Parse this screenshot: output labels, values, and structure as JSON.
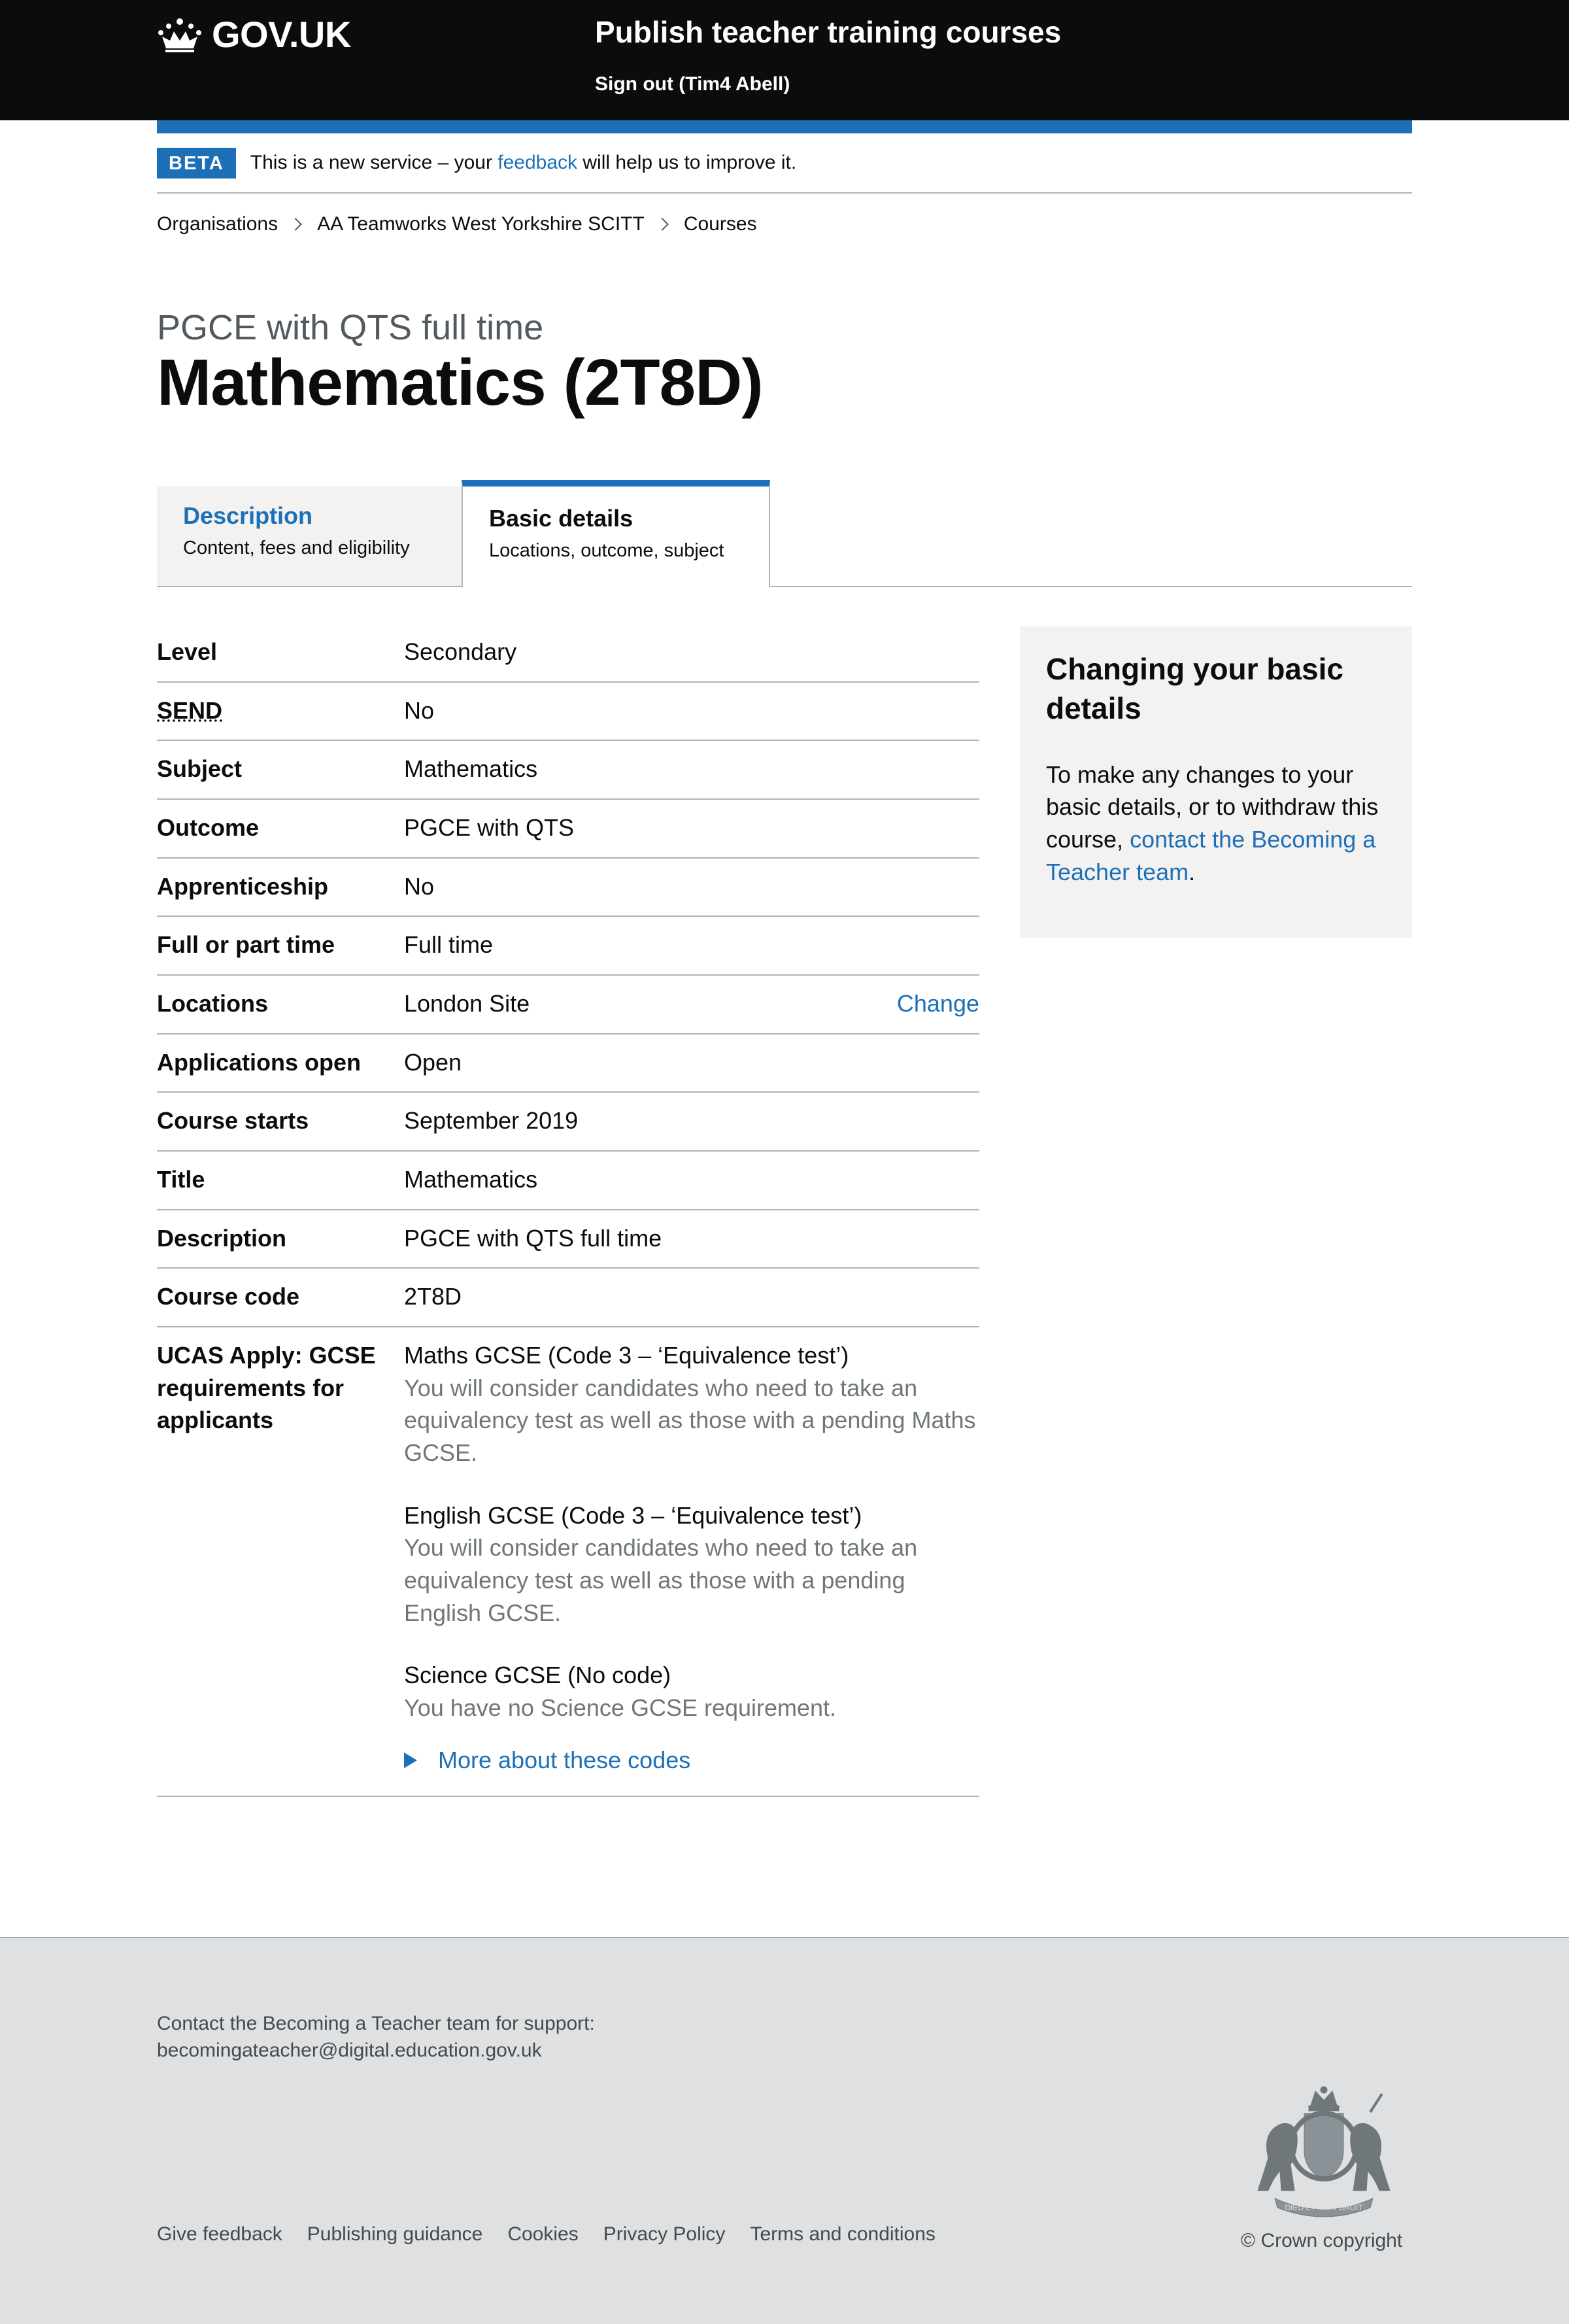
{
  "header": {
    "logo_text": "GOV.UK",
    "service_name": "Publish teacher training courses",
    "signout": "Sign out (Tim4 Abell)"
  },
  "phase": {
    "tag": "BETA",
    "text_before": "This is a new service – your",
    "link": "feedback",
    "text_after": "will help us to improve it."
  },
  "breadcrumbs": [
    "Organisations",
    "AA Teamworks West Yorkshire SCITT",
    "Courses"
  ],
  "page": {
    "caption": "PGCE with QTS full time",
    "title": "Mathematics (2T8D)"
  },
  "tabs": [
    {
      "title": "Description",
      "subtitle": "Content, fees and eligibility"
    },
    {
      "title": "Basic details",
      "subtitle": "Locations, outcome, subject"
    }
  ],
  "summary": [
    {
      "key": "Level",
      "value": "Secondary"
    },
    {
      "key": "SEND",
      "value": "No"
    },
    {
      "key": "Subject",
      "value": "Mathematics"
    },
    {
      "key": "Outcome",
      "value": "PGCE with QTS"
    },
    {
      "key": "Apprenticeship",
      "value": "No"
    },
    {
      "key": "Full or part time",
      "value": "Full time"
    },
    {
      "key": "Locations",
      "value": "London Site",
      "action": "Change"
    },
    {
      "key": "Applications open",
      "value": "Open"
    },
    {
      "key": "Course starts",
      "value": "September 2019"
    },
    {
      "key": "Title",
      "value": "Mathematics"
    },
    {
      "key": "Description",
      "value": "PGCE with QTS full time"
    },
    {
      "key": "Course code",
      "value": "2T8D"
    }
  ],
  "gcse": {
    "key": "UCAS Apply: GCSE requirements for applicants",
    "items": [
      {
        "title": "Maths GCSE (Code 3 – ‘Equivalence test’)",
        "hint": "You will consider candidates who need to take an equivalency test as well as those with a pending Maths GCSE."
      },
      {
        "title": "English GCSE (Code 3 – ‘Equivalence test’)",
        "hint": "You will consider candidates who need to take an equivalency test as well as those with a pending English GCSE."
      },
      {
        "title": "Science GCSE (No code)",
        "hint": "You have no Science GCSE requirement."
      }
    ],
    "details_link": "More about these codes"
  },
  "panel": {
    "title": "Changing your basic details",
    "body_before": "To make any changes to your basic details, or to withdraw this course,",
    "link": "contact the Becoming a Teacher team",
    "body_after": "."
  },
  "footer": {
    "contact_text": "Contact the Becoming a Teacher team for support:",
    "contact_email": "becomingateacher@digital.education.gov.uk",
    "links": [
      "Give feedback",
      "Publishing guidance",
      "Cookies",
      "Privacy Policy",
      "Terms and conditions"
    ],
    "copyright": "© Crown copyright",
    "crest_text": [
      "DIEU ET MON DROIT"
    ]
  }
}
